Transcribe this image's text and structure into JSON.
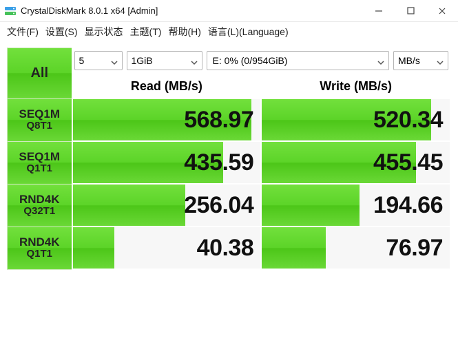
{
  "window": {
    "title": "CrystalDiskMark 8.0.1 x64 [Admin]"
  },
  "menu": {
    "file": "文件(F)",
    "settings": "设置(S)",
    "view": "显示状态",
    "theme": "主题(T)",
    "help": "帮助(H)",
    "language": "语言(L)(Language)"
  },
  "controls": {
    "all_label": "All",
    "runs": "5",
    "size": "1GiB",
    "drive": "E: 0% (0/954GiB)",
    "unit": "MB/s"
  },
  "headers": {
    "read": "Read (MB/s)",
    "write": "Write (MB/s)"
  },
  "tests": {
    "t0": {
      "line1": "SEQ1M",
      "line2": "Q8T1",
      "read": "568.97",
      "write": "520.34",
      "read_bar": 95,
      "write_bar": 90
    },
    "t1": {
      "line1": "SEQ1M",
      "line2": "Q1T1",
      "read": "435.59",
      "write": "455.45",
      "read_bar": 80,
      "write_bar": 82
    },
    "t2": {
      "line1": "RND4K",
      "line2": "Q32T1",
      "read": "256.04",
      "write": "194.66",
      "read_bar": 60,
      "write_bar": 52
    },
    "t3": {
      "line1": "RND4K",
      "line2": "Q1T1",
      "read": "40.38",
      "write": "76.97",
      "read_bar": 22,
      "write_bar": 34
    }
  }
}
